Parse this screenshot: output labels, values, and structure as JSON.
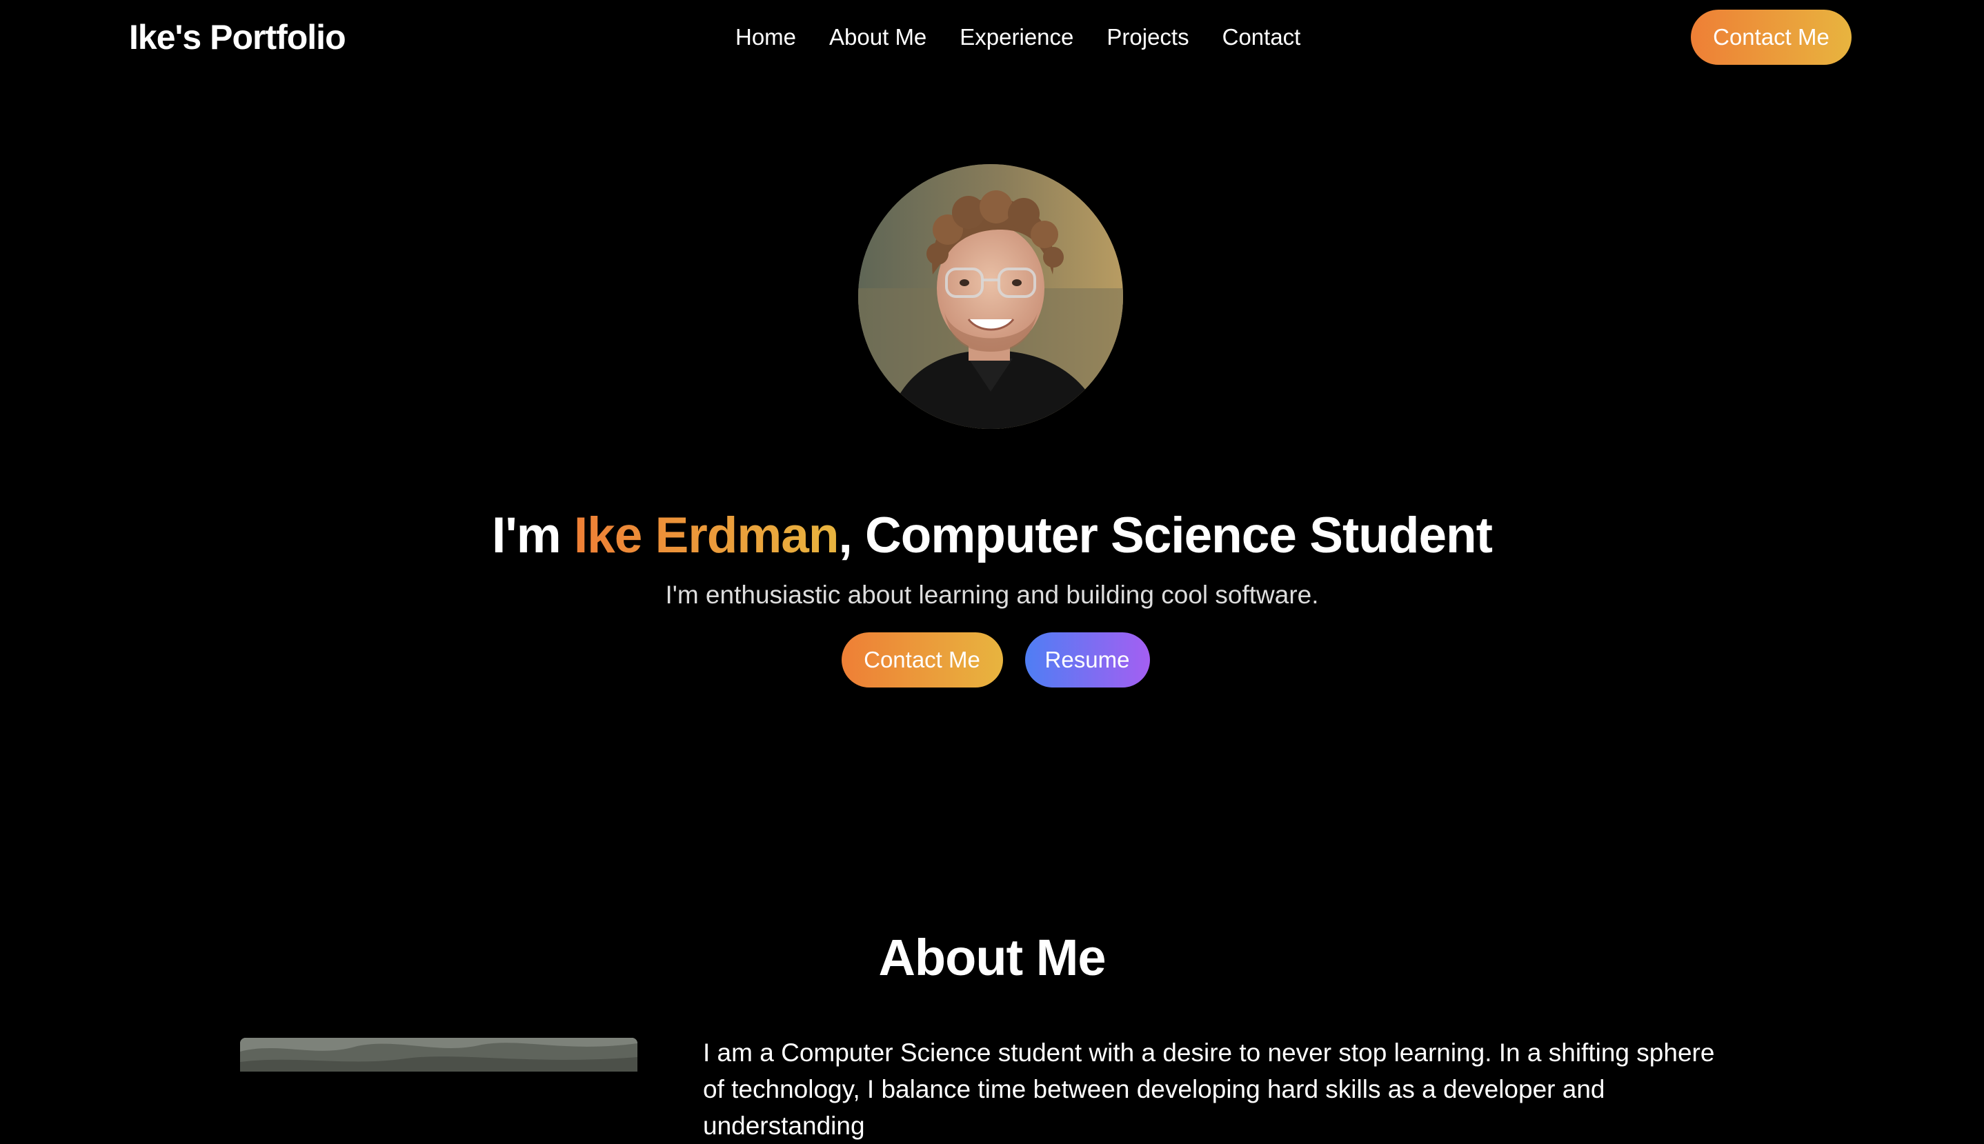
{
  "nav": {
    "brand": "Ike's Portfolio",
    "links": [
      "Home",
      "About Me",
      "Experience",
      "Projects",
      "Contact"
    ],
    "cta_label": "Contact Me"
  },
  "hero": {
    "title_prefix": "I'm ",
    "name": "Ike Erdman",
    "title_suffix": ", Computer Science Student",
    "subtitle": "I'm enthusiastic about learning and building cool software.",
    "contact_label": "Contact Me",
    "resume_label": "Resume"
  },
  "about": {
    "heading": "About Me",
    "text": "I am a Computer Science student with a desire to never stop learning. In a shifting sphere of technology, I balance time between developing hard skills as a developer and understanding"
  },
  "colors": {
    "background": "#000000",
    "accent_orange_start": "#ee7f36",
    "accent_orange_end": "#e8b43f",
    "accent_blue": "#4f7ef3",
    "accent_purple": "#a45ff2"
  }
}
